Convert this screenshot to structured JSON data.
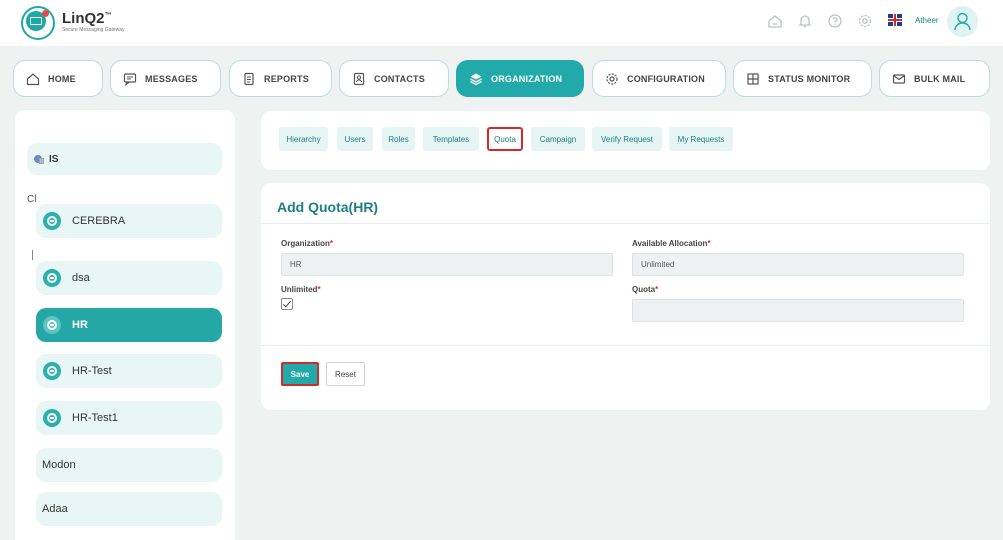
{
  "app": {
    "name": "LinQ2",
    "trademark": "™",
    "tagline": "Secure Messaging Gateway",
    "user_name": "Atheer"
  },
  "header_icons": [
    "home-icon",
    "bell-icon",
    "help-icon",
    "gear-icon",
    "uk-flag-icon",
    "user-icon"
  ],
  "nav": {
    "items": [
      {
        "label": "HOME",
        "icon": "home-icon"
      },
      {
        "label": "MESSAGES",
        "icon": "chat-icon"
      },
      {
        "label": "REPORTS",
        "icon": "document-icon"
      },
      {
        "label": "CONTACTS",
        "icon": "contact-card-icon"
      },
      {
        "label": "ORGANIZATION",
        "icon": "layers-icon",
        "active": true
      },
      {
        "label": "CONFIGURATION",
        "icon": "gear-icon"
      },
      {
        "label": "STATUS MONITOR",
        "icon": "grid-icon"
      },
      {
        "label": "BULK MAIL",
        "icon": "mail-icon"
      }
    ]
  },
  "sidebar": {
    "root": "IS",
    "fragment": "Cl",
    "items": [
      {
        "label": "CEREBRA"
      },
      {
        "label": "dsa"
      },
      {
        "label": "HR",
        "active": true
      },
      {
        "label": "HR-Test"
      },
      {
        "label": "HR-Test1"
      },
      {
        "label": "Modon"
      },
      {
        "label": "Adaa"
      }
    ]
  },
  "tabs": [
    {
      "label": "Hierarchy"
    },
    {
      "label": "Users"
    },
    {
      "label": "Roles"
    },
    {
      "label": "Templates"
    },
    {
      "label": "Quota",
      "selected": true
    },
    {
      "label": "Campaign"
    },
    {
      "label": "Verify Request"
    },
    {
      "label": "My Requests"
    }
  ],
  "form": {
    "title": "Add Quota(HR)",
    "organization_label": "Organization",
    "organization_value": "HR",
    "available_allocation_label": "Available Allocation",
    "available_allocation_value": "Unlimited",
    "unlimited_label": "Unlimited",
    "unlimited_checked": true,
    "quota_label": "Quota",
    "quota_value": "",
    "required_mark": "*",
    "save_label": "Save",
    "reset_label": "Reset"
  },
  "colors": {
    "accent": "#21aaa9",
    "accent_light": "#e8f6f5",
    "highlight_border": "#d22a2a",
    "title_text": "#1e7f82"
  }
}
